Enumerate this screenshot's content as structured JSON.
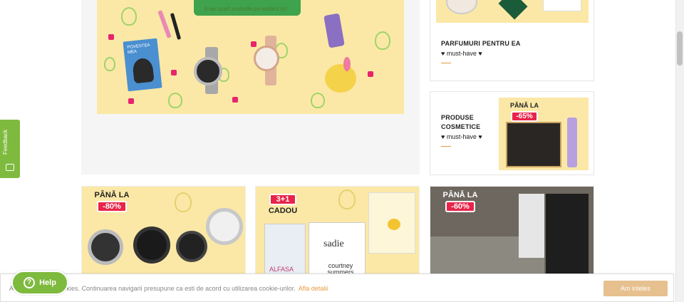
{
  "hero": {
    "subtitle": "S-au spart preturile pe elefant.ro!",
    "book_title": "POVESTEA MEA"
  },
  "cards": [
    {
      "title": "PARFUMURI PENTRU EA",
      "sub": "♥ must-have ♥"
    },
    {
      "title": "PRODUSE COSMETICE",
      "sub": "♥ must-have ♥",
      "badge_top": "PÂNĂ LA",
      "badge_value": "-65%"
    }
  ],
  "tiles": [
    {
      "badge_top": "PÂNĂ LA",
      "badge_value": "-80%"
    },
    {
      "badge_top": "3+1",
      "badge_value": "CADOU",
      "books": [
        "ALFASA",
        "sadie",
        "courtney summers"
      ]
    },
    {
      "badge_top": "PÂNĂ LA",
      "badge_value": "-60%"
    }
  ],
  "cookie": {
    "text": "A                     e cookies. Continuarea navigarii presupune ca esti de acord cu utilizarea cookie-urilor.",
    "link": "Afla detalii",
    "button": "Am inteles"
  },
  "help": {
    "label": "Help",
    "icon": "?"
  },
  "feedback": {
    "label": "Feedback"
  },
  "colors": {
    "accent_green": "#7dba3e",
    "badge_red": "#e8244a",
    "banner_yellow": "#fbe8a6",
    "cookie_button": "#e6c08f",
    "link_orange": "#e89a3c"
  }
}
